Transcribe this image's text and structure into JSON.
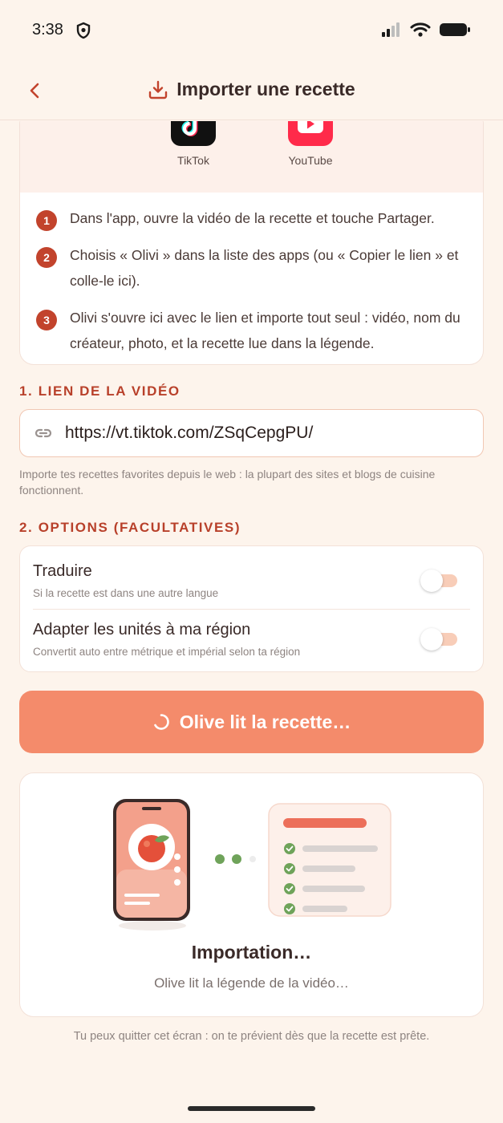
{
  "status_bar": {
    "time": "3:38"
  },
  "header": {
    "title": "Importer une recette",
    "back_icon": "chevron-left-icon",
    "title_icon": "download-icon"
  },
  "platforms": [
    {
      "name": "TikTok",
      "icon": "tiktok-logo"
    },
    {
      "name": "YouTube",
      "icon": "youtube-logo"
    }
  ],
  "steps": [
    {
      "number": "1",
      "text": "Dans l'app, ouvre la vidéo de la recette et touche Partager."
    },
    {
      "number": "2",
      "text": "Choisis « Olivi » dans la liste des apps (ou « Copier le lien » et colle-le ici)."
    },
    {
      "number": "3",
      "text": "Olivi s'ouvre ici avec le lien et importe tout seul : vidéo, nom du créateur, photo, et la recette lue dans la légende."
    }
  ],
  "link_section": {
    "label": "1. LIEN DE LA VIDÉO",
    "value": "https://vt.tiktok.com/ZSqCepgPU/",
    "helper": "Importe tes recettes favorites depuis le web : la plupart des sites et blogs de cuisine fonctionnent."
  },
  "options_section": {
    "label": "2. OPTIONS (FACULTATIVES)",
    "options": [
      {
        "title": "Traduire",
        "subtitle": "Si la recette est dans une autre langue",
        "enabled": false
      },
      {
        "title": "Adapter les unités à ma région",
        "subtitle": "Convertit auto entre métrique et impérial selon ta région",
        "enabled": false
      }
    ]
  },
  "primary_button": {
    "label": "Olive lit la recette…"
  },
  "progress": {
    "title": "Importation…",
    "subtitle": "Olive lit la légende de la vidéo…"
  },
  "footer_note": "Tu peux quitter cet écran : on te prévient dès que la recette est prête.",
  "colors": {
    "accent": "#c2432c",
    "button": "#f48b6b",
    "background": "#fdf4ec",
    "check_green": "#6fa35a"
  }
}
